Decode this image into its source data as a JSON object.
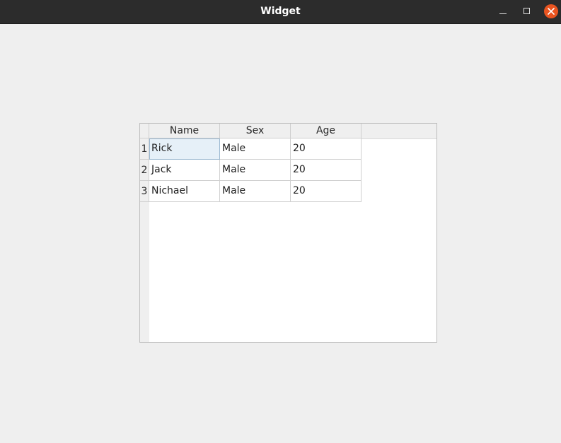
{
  "window": {
    "title": "Widget",
    "buttons": [
      "minimize-icon",
      "maximize-icon",
      "close-icon"
    ],
    "close_color": "#e95420"
  },
  "table": {
    "headers": [
      "Name",
      "Sex",
      "Age"
    ],
    "row_numbers": [
      "1",
      "2",
      "3"
    ],
    "rows": [
      [
        "Rick",
        "Male",
        "20"
      ],
      [
        "Jack",
        "Male",
        "20"
      ],
      [
        "Nichael",
        "Male",
        "20"
      ]
    ],
    "selected_cell": "Rick",
    "selection_color": "#e6f0f8"
  }
}
